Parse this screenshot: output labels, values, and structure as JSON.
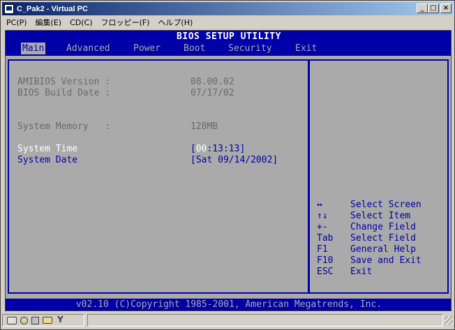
{
  "window": {
    "title": "C_Pak2 - Virtual PC",
    "minimize": "_",
    "maximize": "□",
    "close": "×"
  },
  "menubar": {
    "items": [
      "PC(P)",
      "編集(E)",
      "CD(C)",
      "フロッピー(F)",
      "ヘルプ(H)"
    ]
  },
  "bios": {
    "title": "BIOS SETUP UTILITY",
    "tabs": [
      "Main",
      "Advanced",
      "Power",
      "Boot",
      "Security",
      "Exit"
    ],
    "active_tab": "Main",
    "info": {
      "amibios_label": "AMIBIOS Version :",
      "amibios_value": "08.00.02",
      "build_label": "BIOS Build Date :",
      "build_value": "07/17/02",
      "memory_label": "System Memory   :",
      "memory_value": "128MB"
    },
    "settings": {
      "time_label": "System Time",
      "time_open": "[",
      "time_cursor": "00",
      "time_rest": ":13:13]",
      "date_label": "System Date",
      "date_value": "[Sat 09/14/2002]"
    },
    "help": [
      {
        "key": "↔",
        "desc": "Select Screen"
      },
      {
        "key": "↑↓",
        "desc": "Select Item"
      },
      {
        "key": "+-",
        "desc": "Change Field"
      },
      {
        "key": "Tab",
        "desc": "Select Field"
      },
      {
        "key": "F1",
        "desc": "General Help"
      },
      {
        "key": "F10",
        "desc": "Save and Exit"
      },
      {
        "key": "ESC",
        "desc": "Exit"
      }
    ],
    "footer": "v02.10 (C)Copyright 1985-2001, American Megatrends, Inc."
  },
  "statusbar": {
    "icons": [
      "hard-disk-icon",
      "cd-icon",
      "floppy-icon",
      "shared-folder-icon",
      "network-icon"
    ]
  },
  "colors": {
    "bios_blue": "#0000a8",
    "bios_gray": "#aaaaaa",
    "titlebar_start": "#0a246a",
    "titlebar_end": "#a6caf0"
  }
}
